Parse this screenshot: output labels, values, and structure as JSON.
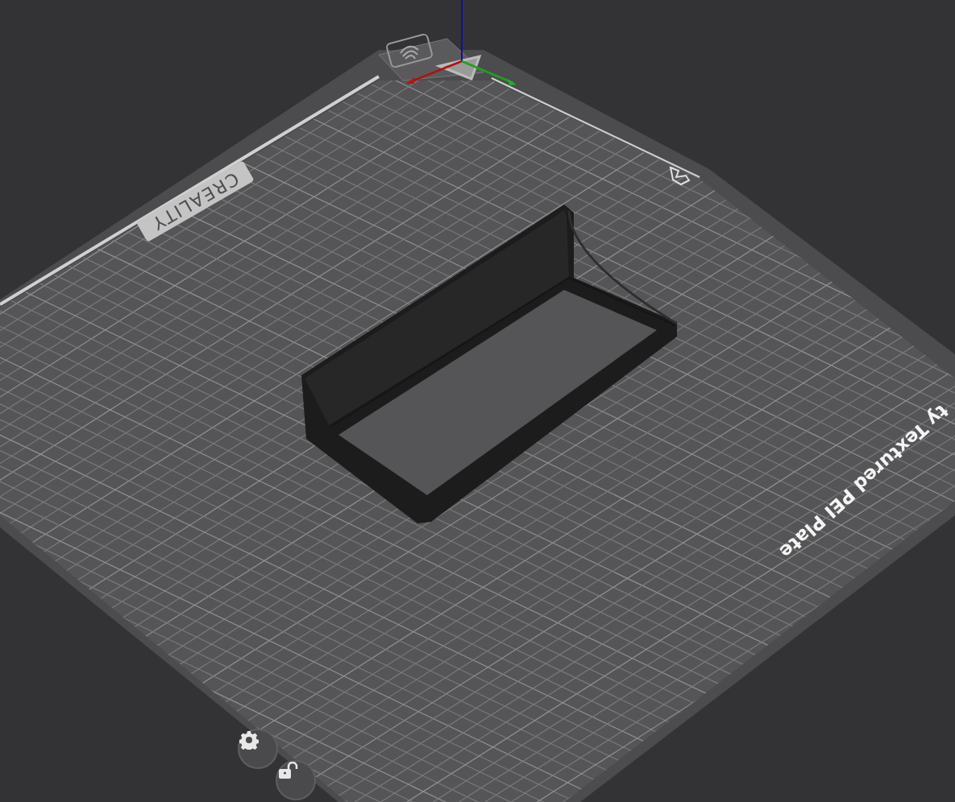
{
  "viewport": {
    "plate": {
      "brand_label": "CREALITY",
      "plate_label": "ty Textured PEI Plate"
    }
  },
  "tools": [
    {
      "kind": "settings"
    },
    {
      "kind": "lock"
    }
  ]
}
